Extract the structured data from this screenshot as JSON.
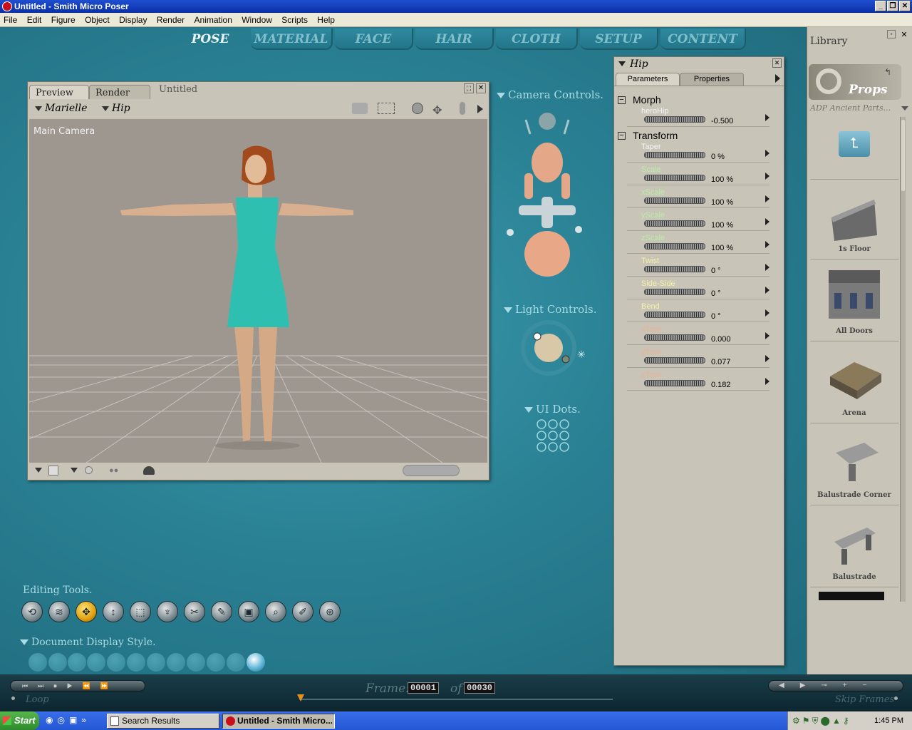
{
  "window": {
    "title": "Untitled - Smith Micro Poser"
  },
  "menu": [
    "File",
    "Edit",
    "Figure",
    "Object",
    "Display",
    "Render",
    "Animation",
    "Window",
    "Scripts",
    "Help"
  ],
  "rooms": [
    "POSE",
    "MATERIAL",
    "FACE",
    "HAIR",
    "CLOTH",
    "SETUP",
    "CONTENT"
  ],
  "preview": {
    "tabs": [
      "Preview",
      "Render"
    ],
    "doc_title": "Untitled",
    "figure": "Marielle",
    "actor": "Hip",
    "camera_label": "Main Camera"
  },
  "camera_controls": {
    "title": "Camera Controls."
  },
  "light_controls": {
    "title": "Light Controls."
  },
  "ui_dots": {
    "title": "UI Dots."
  },
  "params": {
    "actor": "Hip",
    "tabs": [
      "Parameters",
      "Properties"
    ],
    "groups": {
      "morph": "Morph",
      "transform": "Transform"
    },
    "rows": [
      {
        "name": "heroHip",
        "value": "-0.500",
        "color": "#f4f4f4"
      },
      {
        "name": "Taper",
        "value": "0 %",
        "color": "#f4f4f4"
      },
      {
        "name": "Scale",
        "value": "100 %",
        "color": "#b8f0a0"
      },
      {
        "name": "xScale",
        "value": "100 %",
        "color": "#b8f0a0"
      },
      {
        "name": "yScale",
        "value": "100 %",
        "color": "#b8f0a0"
      },
      {
        "name": "zScale",
        "value": "100 %",
        "color": "#b8f0a0"
      },
      {
        "name": "Twist",
        "value": "0 °",
        "color": "#f8f0a0"
      },
      {
        "name": "Side-Side",
        "value": "0 °",
        "color": "#f8f0a0"
      },
      {
        "name": "Bend",
        "value": "0 °",
        "color": "#f8f0a0"
      },
      {
        "name": "xTran",
        "value": "0.000",
        "color": "#f0b090"
      },
      {
        "name": "yTran",
        "value": "0.077",
        "color": "#f0b090"
      },
      {
        "name": "zTran",
        "value": "0.182",
        "color": "#f0b090"
      }
    ]
  },
  "library": {
    "title": "Library",
    "category": "Props",
    "folder": "ADP Ancient Parts...",
    "items": [
      "1s Floor",
      "All Doors",
      "Arena",
      "Balustrade Corner",
      "Balustrade"
    ]
  },
  "editing_tools": {
    "title": "Editing Tools."
  },
  "document_display": {
    "title": "Document Display Style."
  },
  "animation": {
    "frame_label": "Frame:",
    "frame": "00001",
    "of_label": "of",
    "total": "00030",
    "loop": "Loop",
    "skip_frames": "Skip Frames"
  },
  "taskbar": {
    "start": "Start",
    "tasks": [
      "Search Results",
      "Untitled - Smith Micro..."
    ],
    "clock": "1:45 PM"
  }
}
